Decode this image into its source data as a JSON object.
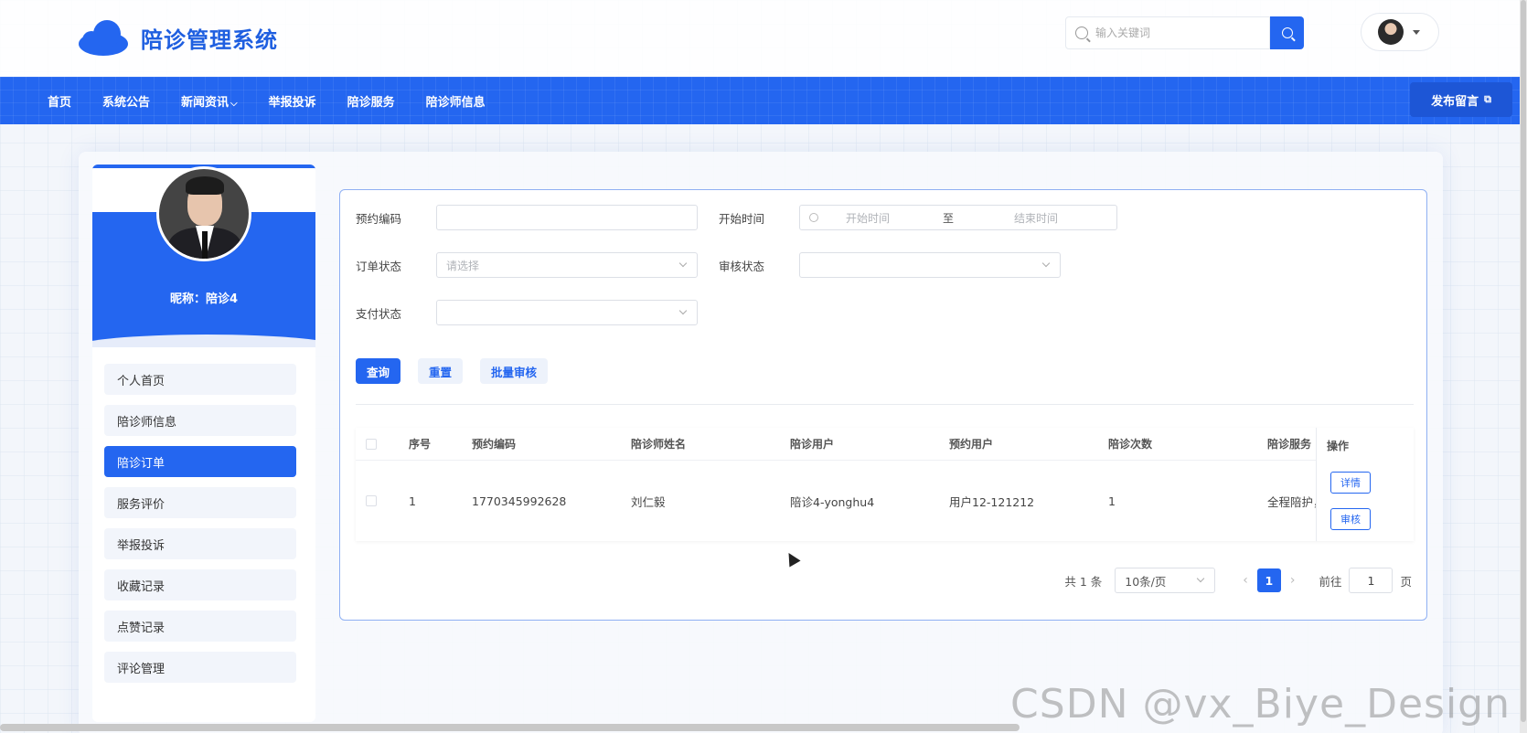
{
  "app": {
    "title": "陪诊管理系统"
  },
  "search": {
    "placeholder": "输入关键词"
  },
  "nav": {
    "items": [
      "首页",
      "系统公告",
      "新闻资讯",
      "举报投诉",
      "陪诊服务",
      "陪诊师信息"
    ],
    "publish": "发布留言"
  },
  "profile": {
    "nickname": "昵称：陪诊4"
  },
  "sidebar": {
    "items": [
      "个人首页",
      "陪诊师信息",
      "陪诊订单",
      "服务评价",
      "举报投诉",
      "收藏记录",
      "点赞记录",
      "评论管理"
    ],
    "active_index": 2
  },
  "filters": {
    "booking_code_label": "预约编码",
    "booking_code_value": "",
    "start_time_label": "开始时间",
    "start_placeholder": "开始时间",
    "range_sep": "至",
    "end_placeholder": "结束时间",
    "order_status_label": "订单状态",
    "order_status_placeholder": "请选择",
    "review_status_label": "审核状态",
    "pay_status_label": "支付状态"
  },
  "buttons": {
    "query": "查询",
    "reset": "重置",
    "batch_review": "批量审核"
  },
  "table": {
    "headers": [
      "序号",
      "预约编码",
      "陪诊师姓名",
      "陪诊用户",
      "预约用户",
      "陪诊次数",
      "陪诊服务",
      "操作"
    ],
    "rows": [
      {
        "index": "1",
        "code": "1770345992628",
        "escort_name": "刘仁毅",
        "escort_user": "陪诊4-yonghu4",
        "booking_user": "用户12-121212",
        "count": "1",
        "service": "全程陪护，"
      }
    ],
    "actions": {
      "detail": "详情",
      "review": "审核"
    }
  },
  "pagination": {
    "total": "共 1 条",
    "page_size": "10条/页",
    "current_page": "1",
    "goto_label": "前往",
    "goto_value": "1",
    "page_suffix": "页"
  },
  "watermark": "CSDN @vx_Biye_Design",
  "colors": {
    "primary": "#2466f0",
    "panel_border": "#8fb0f3"
  }
}
